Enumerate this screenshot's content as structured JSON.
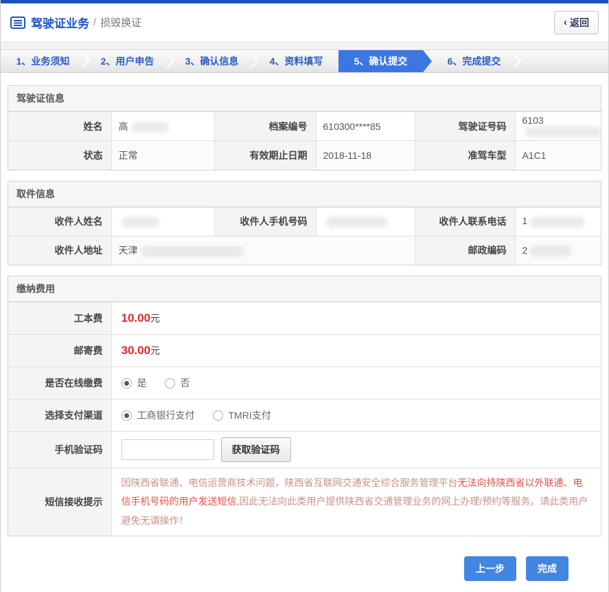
{
  "top": {
    "title": "驾驶证业务",
    "divider": "/",
    "subtitle": "损毁换证",
    "back_icon": "‹",
    "back_label": "返回"
  },
  "steps": [
    {
      "label": "1、业务须知",
      "active": false
    },
    {
      "label": "2、用户申告",
      "active": false
    },
    {
      "label": "3、确认信息",
      "active": false
    },
    {
      "label": "4、资料填写",
      "active": false
    },
    {
      "label": "5、确认提交",
      "active": true
    },
    {
      "label": "6、完成提交",
      "active": false
    }
  ],
  "license_section": {
    "title": "驾驶证信息",
    "fields": {
      "name": {
        "label": "姓名",
        "value": "高"
      },
      "file_no": {
        "label": "档案编号",
        "value": "610300****85"
      },
      "license_no": {
        "label": "驾驶证号码",
        "value": "6103"
      },
      "status": {
        "label": "状态",
        "value": "正常"
      },
      "valid_until": {
        "label": "有效期止日期",
        "value": "2018-11-18"
      },
      "vehicle_class": {
        "label": "准驾车型",
        "value": "A1C1"
      }
    }
  },
  "delivery_section": {
    "title": "取件信息",
    "fields": {
      "recipient_name": {
        "label": "收件人姓名",
        "value": ""
      },
      "recipient_mobile": {
        "label": "收件人手机号码",
        "value": ""
      },
      "recipient_phone": {
        "label": "收件人联系电话",
        "value": "1"
      },
      "recipient_address": {
        "label": "收件人地址",
        "value": "天津"
      },
      "postal_code": {
        "label": "邮政编码",
        "value": "2"
      }
    }
  },
  "payment_section": {
    "title": "缴纳费用",
    "work_fee": {
      "label": "工本费",
      "amount": "10.00",
      "unit": "元"
    },
    "post_fee": {
      "label": "邮寄费",
      "amount": "30.00",
      "unit": "元"
    },
    "online_pay": {
      "label": "是否在线缴费",
      "options": [
        {
          "label": "是",
          "checked": true
        },
        {
          "label": "否",
          "checked": false
        }
      ]
    },
    "channel": {
      "label": "选择支付渠道",
      "options": [
        {
          "label": "工商银行支付",
          "checked": true
        },
        {
          "label": "TMRI支付",
          "checked": false
        }
      ]
    },
    "sms_code": {
      "label": "手机验证码",
      "input_value": "",
      "button_label": "获取验证码"
    },
    "sms_hint": {
      "label": "短信接收提示",
      "text_normal_1": "因陕西省联通、电信运营商技术问题，陕西省互联网交通安全综合服务管理平台",
      "text_emphasis": "无法向持陕西省以外联通、电信手机号码的用户发送短信,",
      "text_normal_2": "因此无法向此类用户提供陕西省交通管理业务的网上办理/预约等服务。请此类用户避免无谓操作！"
    }
  },
  "footer": {
    "prev_label": "上一步",
    "finish_label": "完成"
  },
  "colors": {
    "top_strip_blue": "#1653c4",
    "title_blue": "#1d53c5",
    "step_text_blue": "#2b5cc4",
    "active_step_blue": "#3a77e3",
    "button_blue": "#4285e2",
    "fee_red": "#e8252b",
    "hint_brown": "#c9928a",
    "hint_red": "#e2534a"
  }
}
